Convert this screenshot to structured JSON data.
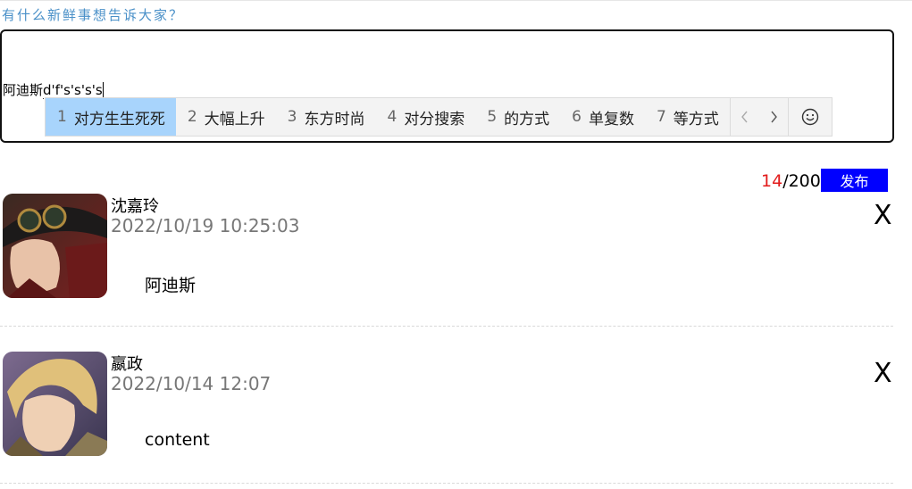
{
  "prompt": "有什么新鲜事想告诉大家？",
  "composer": {
    "committed_text": "阿迪斯",
    "composing_text": "d'f's's's's"
  },
  "ime": {
    "candidates": [
      {
        "n": "1",
        "text": "对方生生死死"
      },
      {
        "n": "2",
        "text": "大幅上升"
      },
      {
        "n": "3",
        "text": "东方时尚"
      },
      {
        "n": "4",
        "text": "对分搜索"
      },
      {
        "n": "5",
        "text": "的方式"
      },
      {
        "n": "6",
        "text": "单复数"
      },
      {
        "n": "7",
        "text": "等方式"
      }
    ],
    "prev_icon": "chevron-left-icon",
    "next_icon": "chevron-right-icon",
    "emoji_icon": "smiley-icon",
    "highlight_color": "#a8d4fc"
  },
  "counter": {
    "current": "14",
    "separator": "/",
    "max": "200"
  },
  "publish_label": "发布",
  "accent_color": "#0000ff",
  "posts": [
    {
      "name": "沈嘉玲",
      "time": "2022/10/19 10:25:03",
      "content": "阿迪斯",
      "delete_label": "X"
    },
    {
      "name": "嬴政",
      "time": "2022/10/14 12:07",
      "content": "content",
      "delete_label": "X"
    }
  ]
}
